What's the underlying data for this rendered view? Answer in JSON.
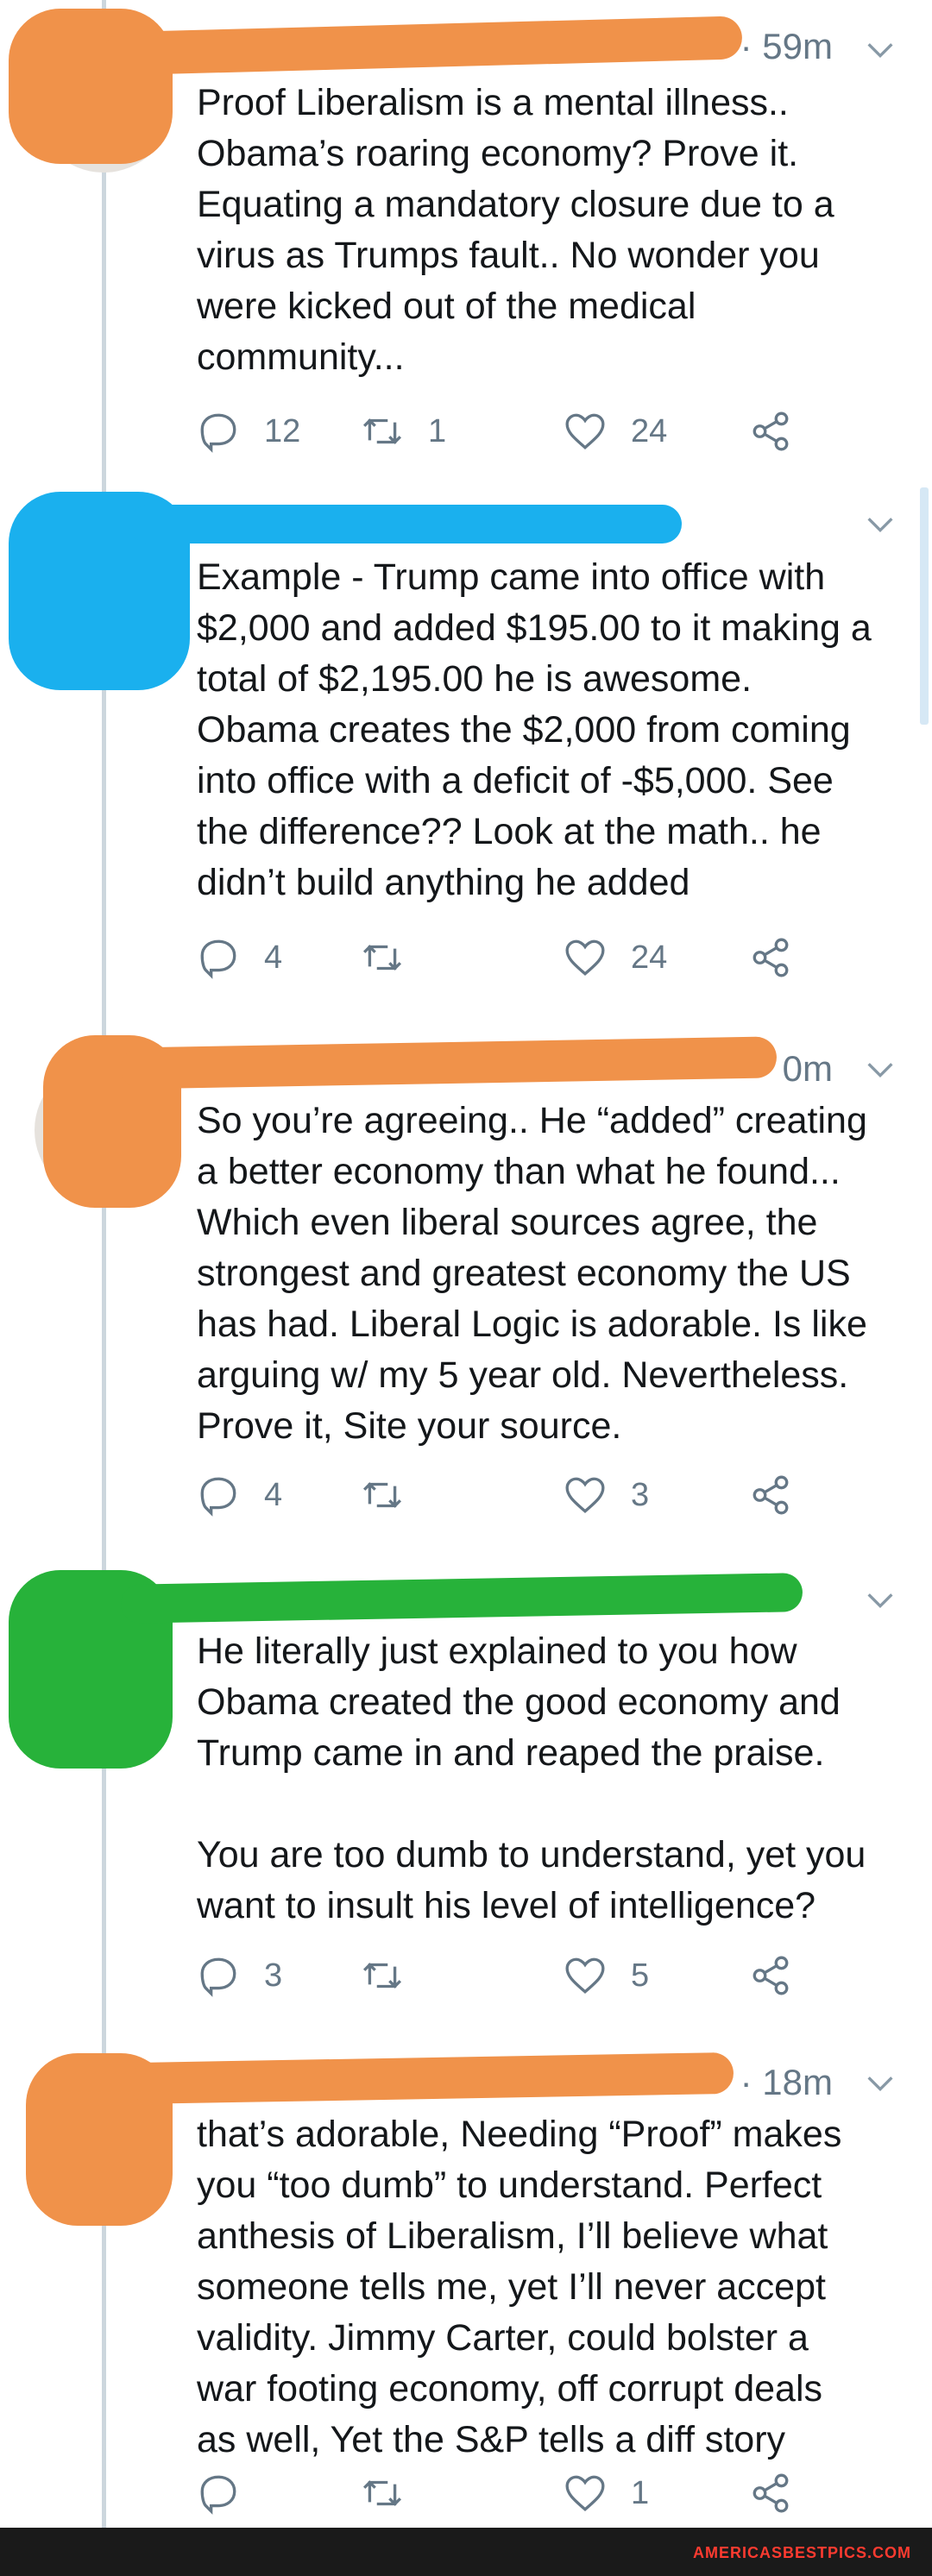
{
  "tweets": [
    {
      "time": "· 59m",
      "text": "Proof Liberalism is a mental illness..\nObama’s roaring economy? Prove it.\nEquating a mandatory closure due to a\nvirus as Trumps fault.. No wonder you\nwere kicked out of the medical\ncommunity...",
      "reply_count": "12",
      "retweet_count": "1",
      "like_count": "24",
      "scribble_color": "#f0924a"
    },
    {
      "time": "",
      "text": "Example - Trump came into office with\n$2,000 and added $195.00 to it making a\ntotal of $2,195.00 he is awesome.\nObama creates the $2,000 from coming\ninto office with a deficit of -$5,000. See\nthe difference?? Look at the math.. he\ndidn’t build anything he added",
      "reply_count": "4",
      "retweet_count": "",
      "like_count": "24",
      "scribble_color": "#1ab0ee"
    },
    {
      "time": "0m",
      "text": "So you’re agreeing.. He “added” creating\na better economy than what he found...\nWhich even liberal sources agree, the\nstrongest and greatest economy the US\nhas had. Liberal Logic is adorable. Is like\narguing w/ my 5 year old. Nevertheless.\nProve it, Site your source.",
      "reply_count": "4",
      "retweet_count": "",
      "like_count": "3",
      "scribble_color": "#f0924a"
    },
    {
      "time": "",
      "text": "He literally just explained to you how\nObama created the good economy and\nTrump came in and reaped the praise.\n\nYou are too dumb to understand, yet you\nwant to insult his level of intelligence?",
      "reply_count": "3",
      "retweet_count": "",
      "like_count": "5",
      "scribble_color": "#27b23a"
    },
    {
      "time": "· 18m",
      "text": "that’s adorable, Needing “Proof” makes\nyou “too dumb” to understand. Perfect\nanthesis of Liberalism, I’ll believe what\nsomeone tells me, yet I’ll never accept\nvalidity. Jimmy Carter, could bolster a\nwar footing economy, off corrupt deals\nas well, Yet the S&P tells a diff story",
      "reply_count": "",
      "retweet_count": "",
      "like_count": "1",
      "scribble_color": "#f0924a"
    }
  ],
  "icons": {
    "reply": "reply-icon",
    "retweet": "retweet-icon",
    "like": "heart-icon",
    "share": "share-icon",
    "menu": "chevron-down-icon"
  },
  "watermark": "AMERICASBESTPICS.COM"
}
